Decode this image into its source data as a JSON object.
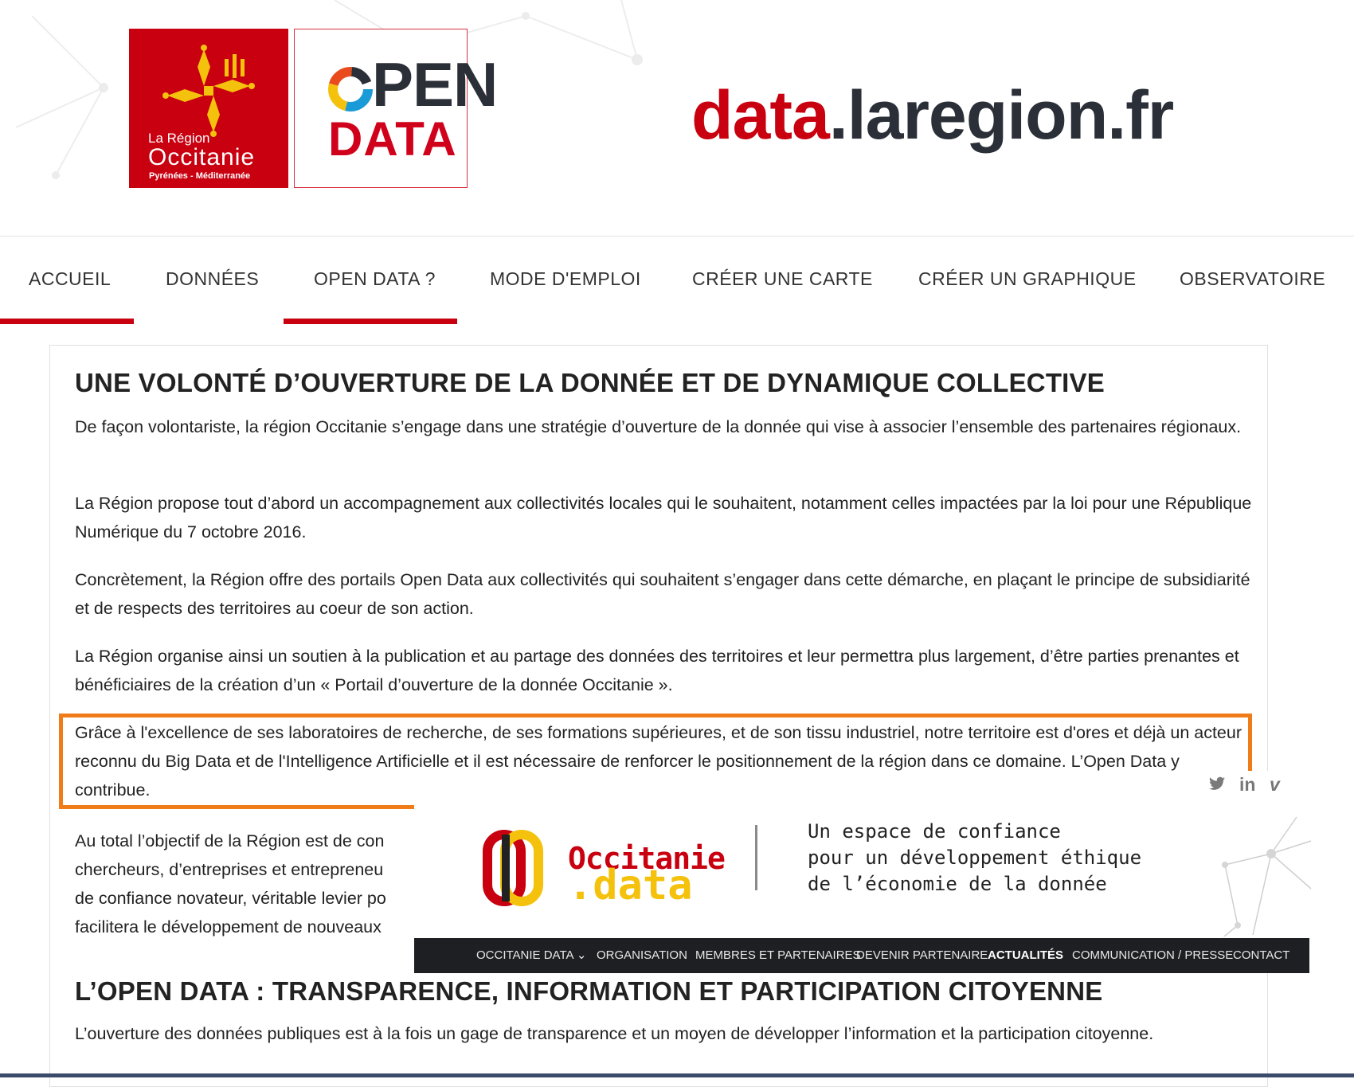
{
  "header": {
    "region_logo": {
      "line1": "La Région",
      "line2": "Occitanie",
      "line3": "Pyrénées - Méditerranée"
    },
    "open_logo": {
      "word1": "PEN",
      "word2": "DATA"
    },
    "site_title": {
      "part1": "data",
      "part2": ".laregion.fr"
    }
  },
  "nav": {
    "items": [
      {
        "label": "ACCUEIL",
        "active": true
      },
      {
        "label": "DONNÉES",
        "active": false
      },
      {
        "label": "OPEN DATA ?",
        "active": true
      },
      {
        "label": "MODE D'EMPLOI",
        "active": false
      },
      {
        "label": "CRÉER UNE CARTE",
        "active": false
      },
      {
        "label": "CRÉER UN GRAPHIQUE",
        "active": false
      },
      {
        "label": "OBSERVATOIRE",
        "active": false
      }
    ],
    "active_color": "#c8000f"
  },
  "content": {
    "heading1": "UNE VOLONTÉ D’OUVERTURE DE LA DONNÉE ET DE DYNAMIQUE COLLECTIVE",
    "paragraphs": [
      "De façon volontariste, la région Occitanie s’engage dans une stratégie d’ouverture de la donnée qui vise à associer l’ensemble des partenaires régionaux.",
      "La Région propose tout d’abord un accompagnement aux collectivités locales qui le souhaitent, notamment celles impactées par la loi pour une République Numérique du 7 octobre 2016.",
      "Concrètement, la Région offre des portails Open Data aux collectivités qui souhaitent s’engager dans cette démarche, en plaçant le principe de subsidiarité et de respects des territoires au coeur de son action.",
      "La Région organise ainsi un soutien à la publication et au partage des données des territoires et leur permettra plus largement, d’être parties prenantes et bénéficiaires de la création d’un « Portail d’ouverture de la donnée Occitanie ».",
      "Grâce à l'excellence de ses laboratoires de recherche, de ses formations supérieures, et de son tissu industriel, notre territoire est d'ores et déjà un acteur reconnu du Big Data et de l'Intelligence Artificielle et il est nécessaire de renforcer le positionnement de la région dans ce domaine. L’Open Data y contribue."
    ],
    "partial_paragraph_lines": [
      "Au total l’objectif de la Région est de con",
      "chercheurs, d’entreprises et entrepreneu",
      "de confiance novateur, véritable levier po",
      "facilitera le développement de nouveaux"
    ],
    "heading2": "L’OPEN DATA : TRANSPARENCE, INFORMATION ET PARTICIPATION CITOYENNE",
    "last_paragraph": "L’ouverture des données publiques est à la fois un gage de transparence et un moyen de développer l’information et la participation citoyenne.",
    "highlight_color": "#f07c19"
  },
  "overlay": {
    "brand_line1": "Occitanie",
    "brand_line2": ".data",
    "tagline": [
      "Un espace de confiance",
      "pour un développement éthique",
      "de l’économie de la donnée"
    ],
    "social": [
      "twitter-icon",
      "linkedin-icon",
      "vimeo-icon"
    ],
    "social_text": {
      "linkedin": "in",
      "vimeo": "v"
    },
    "menu": [
      {
        "label": "OCCITANIE DATA ⌄",
        "current": false
      },
      {
        "label": "ORGANISATION",
        "current": false
      },
      {
        "label": "MEMBRES ET PARTENAIRES",
        "current": false
      },
      {
        "label": "DEVENIR PARTENAIRE",
        "current": false
      },
      {
        "label": "ACTUALITÉS",
        "current": true
      },
      {
        "label": "COMMUNICATION / PRESSE",
        "current": false
      },
      {
        "label": "CONTACT",
        "current": false
      }
    ]
  }
}
